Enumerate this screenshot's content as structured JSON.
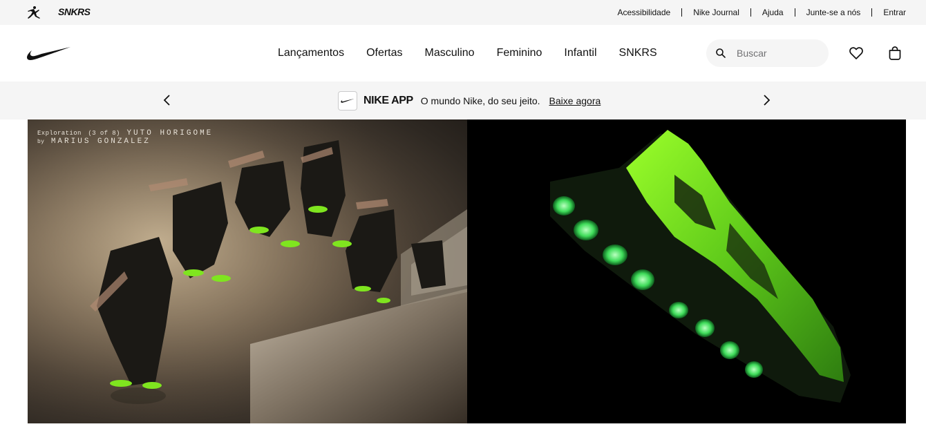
{
  "utility": {
    "brands": [
      "jordan-logo",
      "SNKRS"
    ],
    "links": [
      "Acessibilidade",
      "Nike Journal",
      "Ajuda",
      "Junte-se a nós",
      "Entrar"
    ]
  },
  "header": {
    "logo": "nike-swoosh-logo",
    "nav": [
      "Lançamentos",
      "Ofertas",
      "Masculino",
      "Feminino",
      "Infantil",
      "SNKRS"
    ],
    "search_placeholder": "Buscar",
    "icons": [
      "search-icon",
      "heart-icon",
      "bag-icon"
    ]
  },
  "promo": {
    "app_title": "NIKE APP",
    "text": "O mundo Nike, do seu jeito.",
    "link": "Baixe agora"
  },
  "hero": {
    "caption": {
      "prefix": "Exploration",
      "index": "(3 of 8)",
      "name": "YUTO HORIGOME",
      "by": "by",
      "author": "MARIUS GONZALEZ"
    },
    "left_image": "athlete-jumping-sequence-photo",
    "right_image": "glowing-green-sneaker-photo"
  },
  "colors": {
    "bar_bg": "#f5f5f5",
    "text": "#111111",
    "accent_green": "#7fe51f",
    "hero_right_bg": "#000000"
  }
}
